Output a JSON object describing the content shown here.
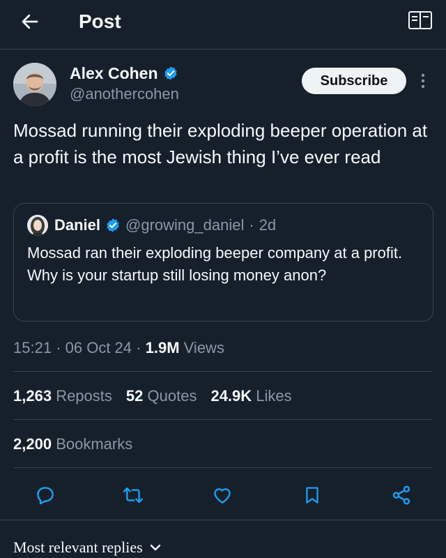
{
  "header": {
    "title": "Post",
    "back_icon": "arrow-left-icon",
    "reader_icon": "reader-mode-icon"
  },
  "author": {
    "name": "Alex Cohen",
    "handle": "@anothercohen",
    "verified": true,
    "verified_color": "#1d9bf0"
  },
  "subscribe_label": "Subscribe",
  "post": {
    "text": "Mossad running their exploding beeper operation at a profit is the most Jewish thing I’ve ever read",
    "time": "15:21",
    "date": "06 Oct 24",
    "views_count": "1.9M",
    "views_label": "Views"
  },
  "quote": {
    "name": "Daniel",
    "handle": "@growing_daniel",
    "age": "2d",
    "text": "Mossad ran their exploding beeper company at a profit. Why is your startup still losing money anon?"
  },
  "stats": {
    "reposts_count": "1,263",
    "reposts_label": "Reposts",
    "quotes_count": "52",
    "quotes_label": "Quotes",
    "likes_count": "24.9K",
    "likes_label": "Likes",
    "bookmarks_count": "2,200",
    "bookmarks_label": "Bookmarks"
  },
  "actions": [
    "reply-icon",
    "repost-icon",
    "like-icon",
    "bookmark-icon",
    "share-icon"
  ],
  "replies_sort": {
    "label": "Most relevant replies"
  },
  "colors": {
    "background": "#15202b",
    "text": "#f7f9f9",
    "muted": "#8b98a5",
    "border": "#38444d",
    "accent": "#1d9bf0"
  }
}
